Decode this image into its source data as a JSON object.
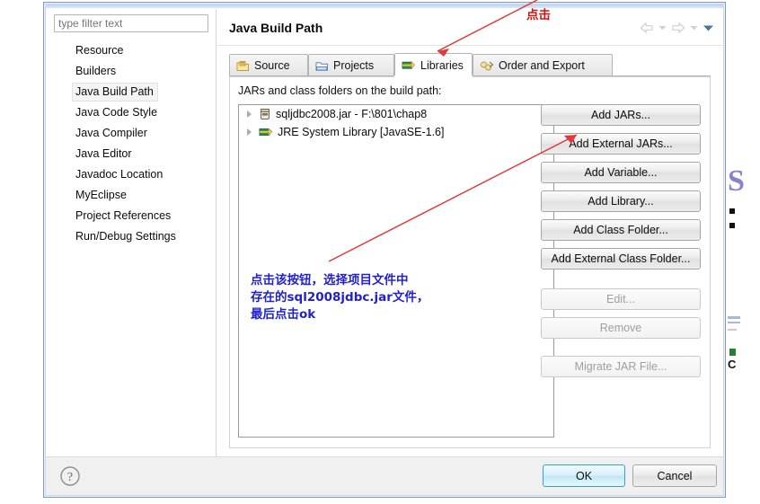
{
  "dialog": {
    "page_title": "Java Build Path",
    "filter_placeholder": "type filter text"
  },
  "sidebar": {
    "items": [
      {
        "label": "Resource",
        "selected": false
      },
      {
        "label": "Builders",
        "selected": false
      },
      {
        "label": "Java Build Path",
        "selected": true
      },
      {
        "label": "Java Code Style",
        "selected": false
      },
      {
        "label": "Java Compiler",
        "selected": false
      },
      {
        "label": "Java Editor",
        "selected": false
      },
      {
        "label": "Javadoc Location",
        "selected": false
      },
      {
        "label": "MyEclipse",
        "selected": false
      },
      {
        "label": "Project References",
        "selected": false
      },
      {
        "label": "Run/Debug Settings",
        "selected": false
      }
    ]
  },
  "tabs": [
    {
      "label": "Source",
      "icon": "source-folder-icon",
      "active": false
    },
    {
      "label": "Projects",
      "icon": "projects-folder-icon",
      "active": false
    },
    {
      "label": "Libraries",
      "icon": "libraries-icon",
      "active": true
    },
    {
      "label": "Order and Export",
      "icon": "order-export-icon",
      "active": false
    }
  ],
  "libraries_tab": {
    "list_label": "JARs and class folders on the build path:",
    "entries": [
      {
        "label": "sqljdbc2008.jar - F:\\801\\chap8",
        "icon": "jar-icon"
      },
      {
        "label": "JRE System Library [JavaSE-1.6]",
        "icon": "jre-library-icon"
      }
    ],
    "buttons": [
      {
        "label": "Add JARs...",
        "enabled": true
      },
      {
        "label": "Add External JARs...",
        "enabled": true
      },
      {
        "label": "Add Variable...",
        "enabled": true
      },
      {
        "label": "Add Library...",
        "enabled": true
      },
      {
        "label": "Add Class Folder...",
        "enabled": true
      },
      {
        "label": "Add External Class Folder...",
        "enabled": true
      },
      {
        "label": "Edit...",
        "enabled": false
      },
      {
        "label": "Remove",
        "enabled": false
      },
      {
        "label": "Migrate JAR File...",
        "enabled": false
      }
    ]
  },
  "footer": {
    "help_label": "?",
    "ok_label": "OK",
    "cancel_label": "Cancel"
  },
  "annotations": {
    "instruction": "点击该按钮，选择项目文件中\n存在的sql2008jdbc.jar文件，\n最后点击ok",
    "click_label": "点击"
  },
  "colors": {
    "annotation_blue": "#2222cc",
    "annotation_red": "#d81111",
    "arrow_red": "#e03a3a",
    "ok_accent": "#2fa4d8",
    "dialog_border": "#7a9cc6"
  }
}
